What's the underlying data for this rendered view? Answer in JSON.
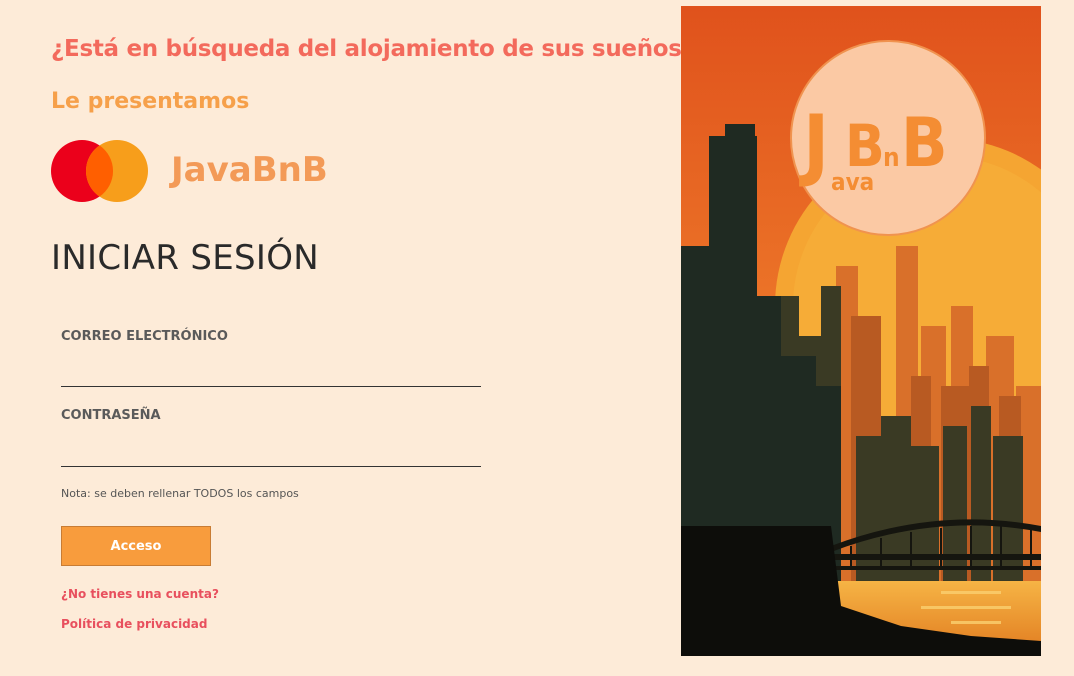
{
  "header": {
    "headline": "¿Está en búsqueda del alojamiento de sus sueños?",
    "subhead": "Le presentamos"
  },
  "brand": {
    "name": "JavaBnB",
    "logo_icon": "two-overlapping-circles-icon",
    "colors": {
      "red": "#eb001b",
      "orange": "#f79e1b",
      "overlap": "#ff5f00"
    }
  },
  "login": {
    "title": "INICIAR SESIÓN",
    "email_label": "CORREO ELECTRÓNICO",
    "email_value": "",
    "password_label": "CONTRASEÑA",
    "password_value": "",
    "note": "Nota: se deben rellenar TODOS los campos",
    "submit_label": "Acceso",
    "signup_link": "¿No tienes una cuenta?",
    "privacy_link": "Política de privacidad"
  },
  "hero": {
    "description_icon": "city-skyline-sunset-illustration",
    "badge_text": "JBnB",
    "badge_subtext": "ava"
  },
  "colors": {
    "background": "#fdebd8",
    "headline": "#f36a5c",
    "subhead": "#f6a04a",
    "button": "#f89c3d",
    "link": "#e8505e"
  }
}
